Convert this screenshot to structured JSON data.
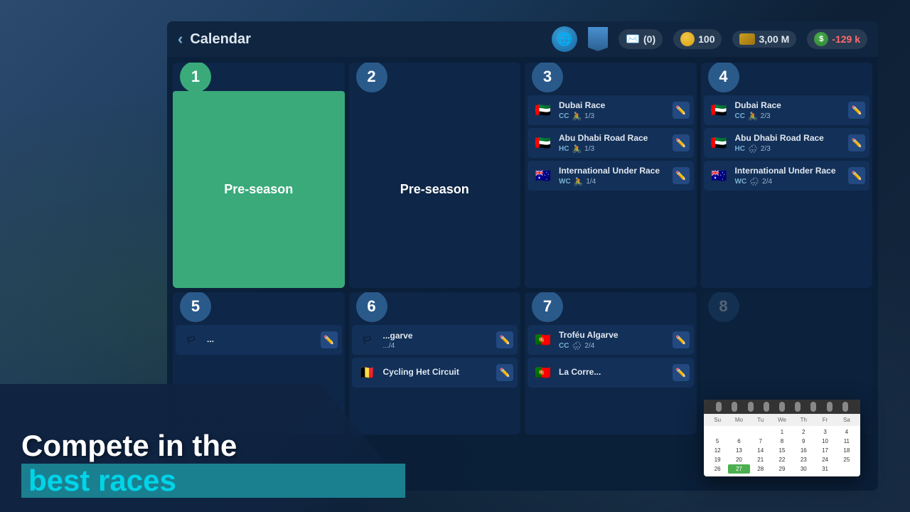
{
  "header": {
    "back_label": "‹",
    "title": "Calendar",
    "globe_icon": "🌐",
    "bookmark_label": "",
    "messages_label": "(0)",
    "coins": "100",
    "money": "3,00 M",
    "balance": "-129 k"
  },
  "weeks": [
    {
      "number": "1",
      "type": "preseason",
      "label": "Pre-season",
      "active": true
    },
    {
      "number": "2",
      "type": "preseason",
      "label": "Pre-season",
      "active": false
    },
    {
      "number": "3",
      "type": "races",
      "active": false,
      "races": [
        {
          "flag": "🇦🇪",
          "name": "Dubai Race",
          "badge": "CC",
          "icon": "🚴",
          "progress": "1/3"
        },
        {
          "flag": "🇦🇪",
          "name": "Abu Dhabi Road Race",
          "badge": "HC",
          "icon": "🚴",
          "progress": "1/3"
        },
        {
          "flag": "🇦🇺",
          "name": "International Under Race",
          "badge": "WC",
          "icon": "🚴",
          "progress": "1/4"
        }
      ]
    },
    {
      "number": "4",
      "type": "races",
      "active": false,
      "races": [
        {
          "flag": "🇦🇪",
          "name": "Dubai Race",
          "badge": "CC",
          "icon": "🚴",
          "progress": "2/3"
        },
        {
          "flag": "🇦🇪",
          "name": "Abu Dhabi Road Race",
          "badge": "HC",
          "icon": "🌧",
          "progress": "2/3"
        },
        {
          "flag": "🇦🇺",
          "name": "International Under Race",
          "badge": "WC",
          "icon": "🌧",
          "progress": "2/4"
        }
      ]
    },
    {
      "number": "5",
      "type": "partial",
      "active": false,
      "races": []
    },
    {
      "number": "6",
      "type": "partial",
      "active": false,
      "races": [
        {
          "flag": "🏳",
          "name": "...garve",
          "badge": "",
          "icon": "",
          "progress": ".../4"
        },
        {
          "flag": "🇧🇪",
          "name": "Cycling Het Circuit",
          "badge": "",
          "icon": "",
          "progress": ""
        }
      ]
    },
    {
      "number": "7",
      "type": "partial",
      "active": false,
      "races": [
        {
          "flag": "🇵🇹",
          "name": "Troféu Algarve",
          "badge": "CC",
          "icon": "🌧",
          "progress": "2/4"
        },
        {
          "flag": "🏳",
          "name": "La Corre...",
          "badge": "",
          "icon": "",
          "progress": ""
        }
      ]
    }
  ],
  "overlay": {
    "line1": "Compete in the",
    "line2": "best races"
  },
  "calendar_widget": {
    "day_names": [
      "Sunday",
      "Monday",
      "Tuesday",
      "Wednesday",
      "Thursday",
      "Friday",
      "Saturday"
    ],
    "day_abbr": [
      "Su",
      "Mo",
      "Tu",
      "We",
      "Th",
      "Fr",
      "Sa"
    ],
    "weeks": [
      [
        "",
        "",
        "",
        "1",
        "2",
        "3",
        "4"
      ],
      [
        "5",
        "6",
        "7",
        "8",
        "9",
        "10",
        "11"
      ],
      [
        "12",
        "13",
        "14",
        "15",
        "16",
        "17",
        "18"
      ],
      [
        "19",
        "20",
        "21",
        "22",
        "23",
        "24",
        "25"
      ],
      [
        "26",
        "27",
        "28",
        "29",
        "30",
        "31",
        ""
      ]
    ],
    "today": "27"
  }
}
